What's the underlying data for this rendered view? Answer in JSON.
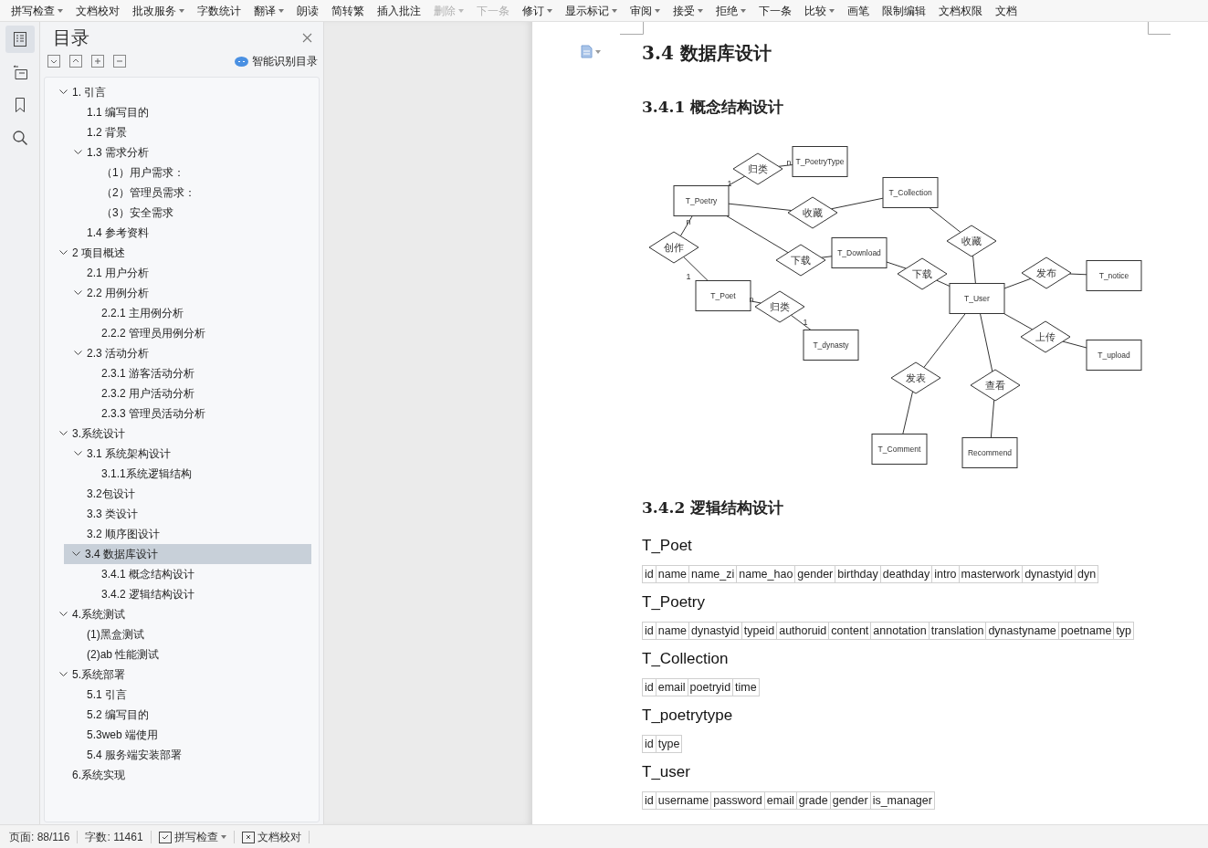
{
  "toolbar": {
    "items": [
      {
        "label": "拼写检查",
        "dropdown": true,
        "disabled": false
      },
      {
        "label": "文档校对",
        "dropdown": false,
        "disabled": false
      },
      {
        "label": "批改服务",
        "dropdown": true,
        "disabled": false
      },
      {
        "label": "字数统计",
        "dropdown": false,
        "disabled": false
      },
      {
        "label": "翻译",
        "dropdown": true,
        "disabled": false
      },
      {
        "label": "朗读",
        "dropdown": false,
        "disabled": false
      },
      {
        "label": "简转繁",
        "dropdown": false,
        "disabled": false
      },
      {
        "label": "插入批注",
        "dropdown": false,
        "disabled": false
      },
      {
        "label": "删除",
        "dropdown": true,
        "disabled": true
      },
      {
        "label": "下一条",
        "dropdown": false,
        "disabled": true
      },
      {
        "label": "修订",
        "dropdown": true,
        "disabled": false
      },
      {
        "label": "显示标记",
        "dropdown": true,
        "disabled": false
      },
      {
        "label": "审阅",
        "dropdown": true,
        "disabled": false
      },
      {
        "label": "接受",
        "dropdown": true,
        "disabled": false
      },
      {
        "label": "拒绝",
        "dropdown": true,
        "disabled": false
      },
      {
        "label": "下一条",
        "dropdown": false,
        "disabled": false
      },
      {
        "label": "比较",
        "dropdown": true,
        "disabled": false
      },
      {
        "label": "画笔",
        "dropdown": false,
        "disabled": false
      },
      {
        "label": "限制编辑",
        "dropdown": false,
        "disabled": false
      },
      {
        "label": "文档权限",
        "dropdown": false,
        "disabled": false
      },
      {
        "label": "文档",
        "dropdown": false,
        "disabled": false
      }
    ]
  },
  "side_rail": {
    "items": [
      {
        "kind": "toc",
        "selected": true
      },
      {
        "kind": "outline",
        "selected": false
      },
      {
        "kind": "bookmark",
        "selected": false
      },
      {
        "kind": "search",
        "selected": false
      }
    ]
  },
  "toc_panel": {
    "title": "目录",
    "smart_button": "智能识别目录",
    "tree": [
      {
        "label": "1. 引言",
        "expanded": true,
        "selected": false,
        "children": [
          {
            "label": "1.1 编写目的",
            "selected": false
          },
          {
            "label": "1.2 背景",
            "selected": false
          },
          {
            "label": "1.3 需求分析",
            "expanded": true,
            "selected": false,
            "children": [
              {
                "label": "（1）用户需求：",
                "selected": false
              },
              {
                "label": "（2）管理员需求：",
                "selected": false
              },
              {
                "label": "（3）安全需求",
                "selected": false
              }
            ]
          },
          {
            "label": "1.4 参考资料",
            "selected": false
          }
        ]
      },
      {
        "label": "2 项目概述",
        "expanded": true,
        "selected": false,
        "children": [
          {
            "label": "2.1  用户分析",
            "selected": false
          },
          {
            "label": "2.2  用例分析",
            "expanded": true,
            "selected": false,
            "children": [
              {
                "label": "2.2.1  主用例分析",
                "selected": false
              },
              {
                "label": "2.2.2  管理员用例分析",
                "selected": false
              }
            ]
          },
          {
            "label": "2.3  活动分析",
            "expanded": true,
            "selected": false,
            "children": [
              {
                "label": "2.3.1  游客活动分析",
                "selected": false
              },
              {
                "label": "2.3.2  用户活动分析",
                "selected": false
              },
              {
                "label": "2.3.3  管理员活动分析",
                "selected": false
              }
            ]
          }
        ]
      },
      {
        "label": "3.系统设计",
        "expanded": true,
        "selected": false,
        "children": [
          {
            "label": "3.1  系统架构设计",
            "expanded": true,
            "selected": false,
            "children": [
              {
                "label": "3.1.1系统逻辑结构",
                "selected": false
              }
            ]
          },
          {
            "label": "3.2包设计",
            "selected": false
          },
          {
            "label": "3.3 类设计",
            "selected": false
          },
          {
            "label": "3.2 顺序图设计",
            "selected": false
          },
          {
            "label": "3.4  数据库设计",
            "expanded": true,
            "selected": true,
            "children": [
              {
                "label": "3.4.1  概念结构设计",
                "selected": false
              },
              {
                "label": "3.4.2 逻辑结构设计",
                "selected": false
              }
            ]
          }
        ]
      },
      {
        "label": "4.系统测试",
        "expanded": true,
        "selected": false,
        "children": [
          {
            "label": "(1)黑盒测试",
            "selected": false
          },
          {
            "label": "(2)ab 性能测试",
            "selected": false
          }
        ]
      },
      {
        "label": "5.系统部署",
        "expanded": true,
        "selected": false,
        "children": [
          {
            "label": "5.1 引言",
            "selected": false
          },
          {
            "label": "5.2 编写目的",
            "selected": false
          },
          {
            "label": "5.3web 端使用",
            "selected": false
          },
          {
            "label": "5.4 服务端安装部署",
            "selected": false
          }
        ]
      },
      {
        "label": "6.系统实现",
        "selected": false
      }
    ]
  },
  "document": {
    "heading": "3.4  数据库设计",
    "subheading_1": "3.4.1  概念结构设计",
    "er_diagram": {
      "entities": [
        "T_PoetryType",
        "T_Poetry",
        "T_Collection",
        "T_Download",
        "T_Poet",
        "T_dynasty",
        "T_User",
        "T_notice",
        "T_upload",
        "T_Comment",
        "Recommend"
      ],
      "relationships": [
        "归类",
        "收藏",
        "创作",
        "下载",
        "归类",
        "下载",
        "收藏",
        "发布",
        "上传",
        "发表",
        "查看"
      ],
      "cardinalities": [
        "1",
        "n",
        "n",
        "1",
        "n",
        "1"
      ]
    },
    "subheading_2": "3.4.2 逻辑结构设计",
    "tables": [
      {
        "name": "T_Poet",
        "columns": [
          "id",
          "name",
          "name_zi",
          "name_hao",
          "gender",
          "birthday",
          "deathday",
          "intro",
          "masterwork",
          "dynastyid",
          "dyn"
        ]
      },
      {
        "name": "T_Poetry",
        "columns": [
          "id",
          "name",
          "dynastyid",
          "typeid",
          "authoruid",
          "content",
          "annotation",
          "translation",
          "dynastyname",
          "poetname",
          "typ"
        ]
      },
      {
        "name": "T_Collection",
        "columns": [
          "id",
          "email",
          "poetryid",
          "time"
        ]
      },
      {
        "name": "T_poetrytype",
        "columns": [
          "id",
          "type"
        ]
      },
      {
        "name": "T_user",
        "columns": [
          "id",
          "username",
          "password",
          "email",
          "grade",
          "gender",
          "is_manager"
        ]
      }
    ]
  },
  "status_bar": {
    "page": "页面: 88/116",
    "words": "字数: 11461",
    "spell_check": "拼写检查",
    "proofread": "文档校对"
  }
}
